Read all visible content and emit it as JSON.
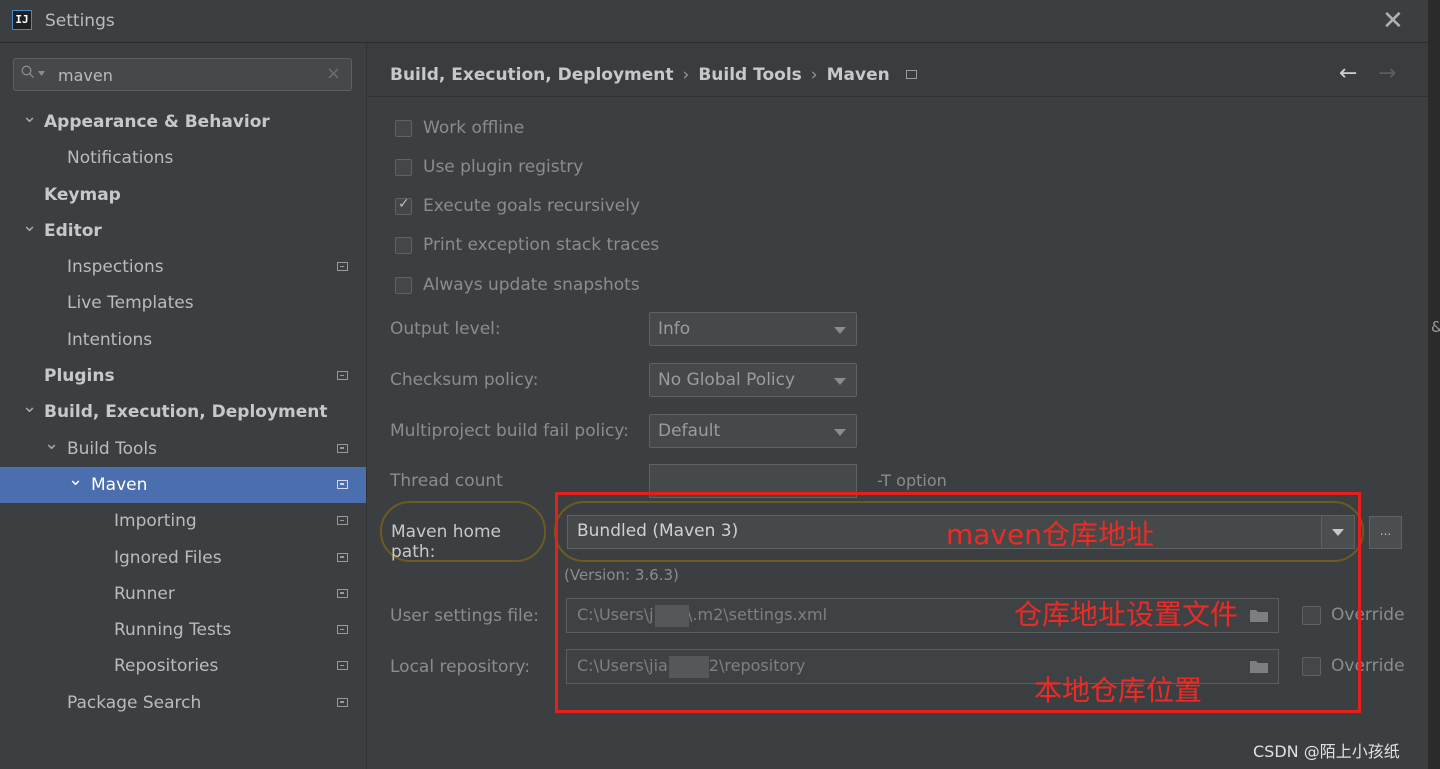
{
  "window": {
    "title": "Settings",
    "app_icon_text": "IJ",
    "close_glyph": "✕"
  },
  "search": {
    "value": "maven",
    "clear_glyph": "×"
  },
  "tree": [
    {
      "label": "Appearance & Behavior",
      "bold": true,
      "expanded": true,
      "level": 0,
      "has_icon": false
    },
    {
      "label": "Notifications",
      "bold": false,
      "level": 1,
      "has_icon": false
    },
    {
      "label": "Keymap",
      "bold": true,
      "level": 0,
      "has_icon": false
    },
    {
      "label": "Editor",
      "bold": true,
      "expanded": true,
      "level": 0,
      "has_icon": false
    },
    {
      "label": "Inspections",
      "bold": false,
      "level": 1,
      "has_icon": true
    },
    {
      "label": "Live Templates",
      "bold": false,
      "level": 1,
      "has_icon": false
    },
    {
      "label": "Intentions",
      "bold": false,
      "level": 1,
      "has_icon": false
    },
    {
      "label": "Plugins",
      "bold": true,
      "level": 0,
      "has_icon": true
    },
    {
      "label": "Build, Execution, Deployment",
      "bold": true,
      "expanded": true,
      "level": 0,
      "has_icon": false
    },
    {
      "label": "Build Tools",
      "bold": false,
      "expanded": true,
      "level": 1,
      "has_icon": true
    },
    {
      "label": "Maven",
      "bold": false,
      "expanded": true,
      "level": 2,
      "has_icon": true,
      "selected": true
    },
    {
      "label": "Importing",
      "bold": false,
      "level": 3,
      "has_icon": true
    },
    {
      "label": "Ignored Files",
      "bold": false,
      "level": 3,
      "has_icon": true
    },
    {
      "label": "Runner",
      "bold": false,
      "level": 3,
      "has_icon": true
    },
    {
      "label": "Running Tests",
      "bold": false,
      "level": 3,
      "has_icon": true
    },
    {
      "label": "Repositories",
      "bold": false,
      "level": 3,
      "has_icon": true
    },
    {
      "label": "Package Search",
      "bold": false,
      "level": 1,
      "has_icon": true
    }
  ],
  "breadcrumb": {
    "items": [
      "Build, Execution, Deployment",
      "Build Tools",
      "Maven"
    ],
    "separator": "›"
  },
  "nav": {
    "back": "←",
    "forward": "→"
  },
  "checkboxes": [
    {
      "label": "Work offline",
      "checked": false
    },
    {
      "label": "Use plugin registry",
      "checked": false
    },
    {
      "label": "Execute goals recursively",
      "checked": true
    },
    {
      "label": "Print exception stack traces",
      "checked": false
    },
    {
      "label": "Always update snapshots",
      "checked": false
    }
  ],
  "fields": {
    "output_level": {
      "label": "Output level:",
      "value": "Info"
    },
    "checksum_policy": {
      "label": "Checksum policy:",
      "value": "No Global Policy"
    },
    "fail_policy": {
      "label": "Multiproject build fail policy:",
      "value": "Default"
    },
    "thread_count": {
      "label": "Thread count",
      "value": "",
      "hint": "-T option"
    },
    "maven_home": {
      "label": "Maven home path:",
      "value": "Bundled (Maven 3)",
      "browse": "...",
      "version": "(Version: 3.6.3)"
    },
    "user_settings": {
      "label": "User settings file:",
      "value": "C:\\Users\\j oke\\.m2\\settings.xml",
      "override": "Override"
    },
    "local_repo": {
      "label": "Local repository:",
      "value": "C:\\Users\\jia e\\.m2\\repository",
      "override": "Override"
    }
  },
  "annotations": {
    "maven_home": "maven仓库地址",
    "settings_file": "仓库地址设置文件",
    "local_repo": "本地仓库位置"
  },
  "watermark": "CSDN @陌上小孩纸",
  "right_edge_glyph": "&",
  "colors": {
    "accent_selection": "#4b6eaf",
    "annotation_red": "#e5201b",
    "highlight_outline": "#6b5a23"
  }
}
